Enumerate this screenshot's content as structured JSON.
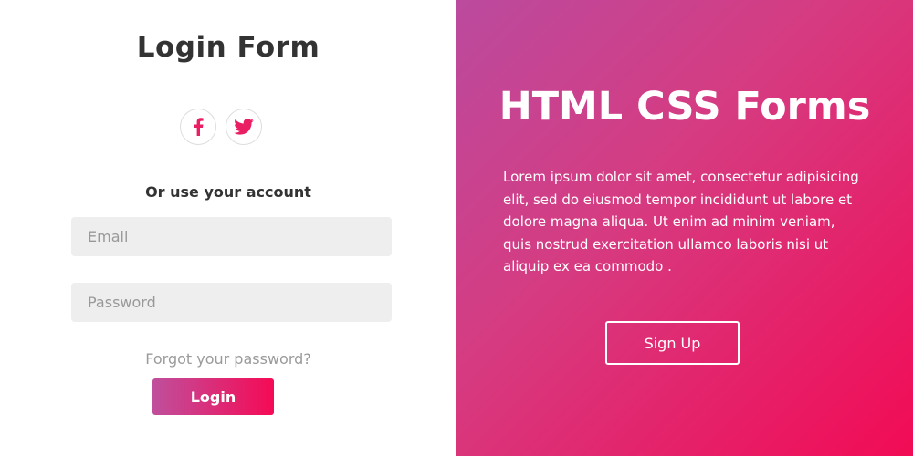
{
  "login": {
    "title": "Login Form",
    "social": [
      {
        "icon": "facebook-icon"
      },
      {
        "icon": "twitter-icon"
      }
    ],
    "subtitle": "Or use your account",
    "email_placeholder": "Email",
    "password_placeholder": "Password",
    "forgot_label": "Forgot your password?",
    "login_label": "Login"
  },
  "hero": {
    "title": "HTML CSS Forms",
    "text": "Lorem ipsum dolor sit amet, consectetur adipisicing elit, sed do eiusmod tempor incididunt ut labore et dolore magna aliqua. Ut enim ad minim veniam, quis nostrud exercitation ullamco laboris nisi ut aliquip ex ea commodo .",
    "signup_label": "Sign Up"
  },
  "colors": {
    "accent": "#e91e63",
    "gradient_start": "#bb4a9e",
    "gradient_end": "#f20b55",
    "heading": "#333333",
    "field_bg": "#eeeeee"
  }
}
